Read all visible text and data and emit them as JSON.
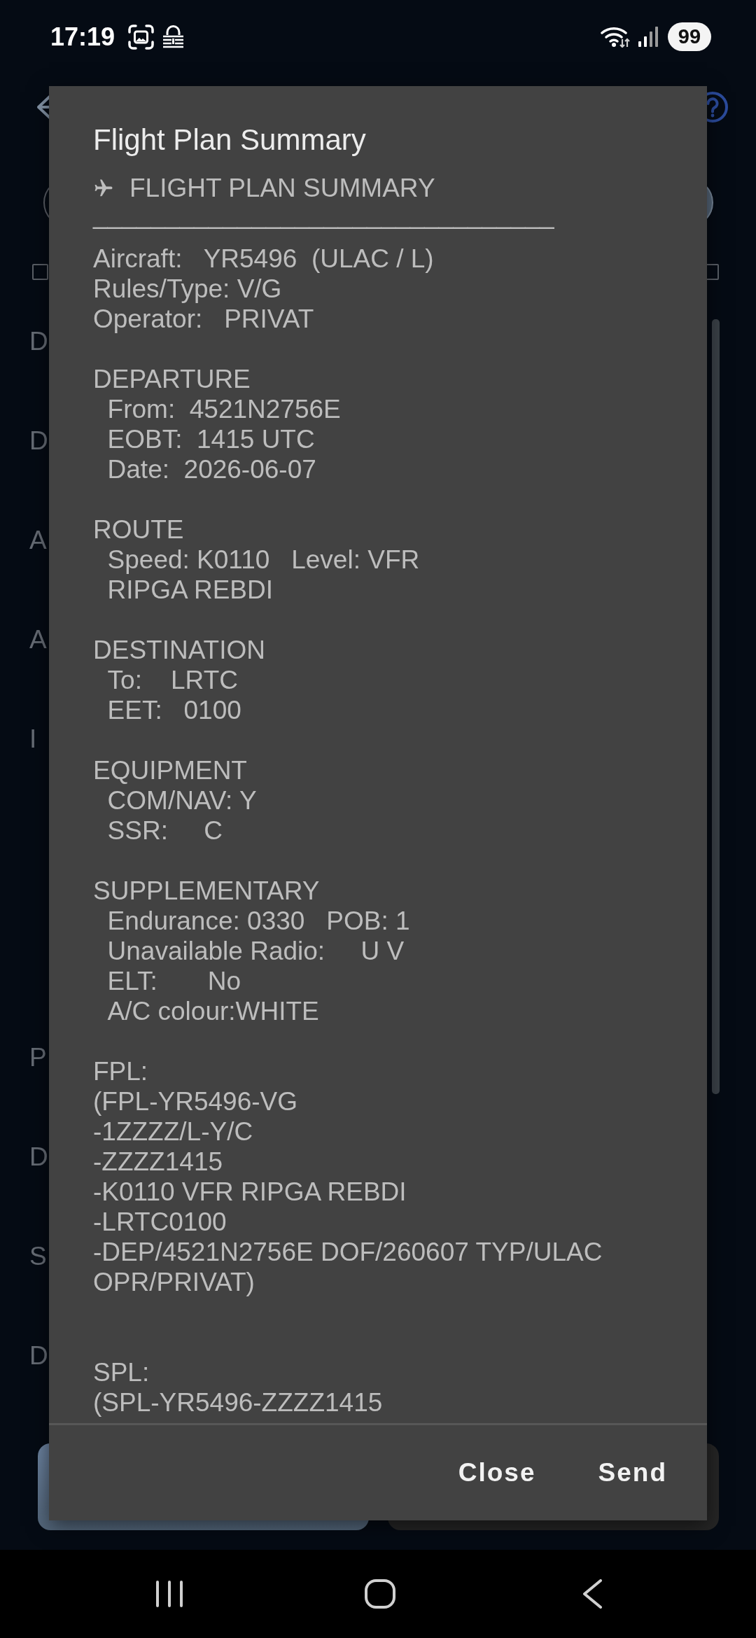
{
  "status_bar": {
    "time": "17:19",
    "battery": "99"
  },
  "background_screen": {
    "checkboxes": [
      {
        "checked": false
      },
      {
        "checked": false
      }
    ],
    "labels_upper": [
      "D",
      "D",
      "A",
      "A",
      "I"
    ],
    "labels_lower": [
      "P",
      "D",
      "S",
      "D"
    ]
  },
  "dialog": {
    "title": "Flight Plan Summary",
    "heading": "FLIGHT PLAN SUMMARY",
    "rule": "________________________________",
    "sections": [
      {
        "kind": "fields",
        "lines": [
          "Aircraft:   YR5496  (ULAC / L)",
          "Rules/Type: V/G",
          "Operator:   PRIVAT"
        ]
      },
      {
        "kind": "fields",
        "lines": [
          "DEPARTURE",
          "  From:  4521N2756E",
          "  EOBT:  1415 UTC",
          "  Date:  2026-06-07"
        ]
      },
      {
        "kind": "fields",
        "lines": [
          "ROUTE",
          "  Speed: K0110   Level: VFR",
          "  RIPGA REBDI"
        ]
      },
      {
        "kind": "fields",
        "lines": [
          "DESTINATION",
          "  To:    LRTC",
          "  EET:   0100"
        ]
      },
      {
        "kind": "fields",
        "lines": [
          "EQUIPMENT",
          "  COM/NAV: Y",
          "  SSR:     C"
        ]
      },
      {
        "kind": "fields",
        "lines": [
          "SUPPLEMENTARY",
          "  Endurance: 0330   POB: 1",
          "  Unavailable Radio:     U V",
          "  ELT:       No",
          "  A/C colour:WHITE"
        ]
      },
      {
        "kind": "message",
        "lines": [
          "FPL:",
          "(FPL-YR5496-VG",
          "-1ZZZZ/L-Y/C",
          "-ZZZZ1415",
          "-K0110 VFR RIPGA REBDI",
          "-LRTC0100",
          "-DEP/4521N2756E DOF/260607 TYP/ULAC OPR/PRIVAT)"
        ]
      },
      {
        "kind": "message",
        "lines": [
          "SPL:",
          "(SPL-YR5496-ZZZZ1415"
        ]
      }
    ],
    "buttons": [
      {
        "label": "Close"
      },
      {
        "label": "Send"
      }
    ]
  }
}
